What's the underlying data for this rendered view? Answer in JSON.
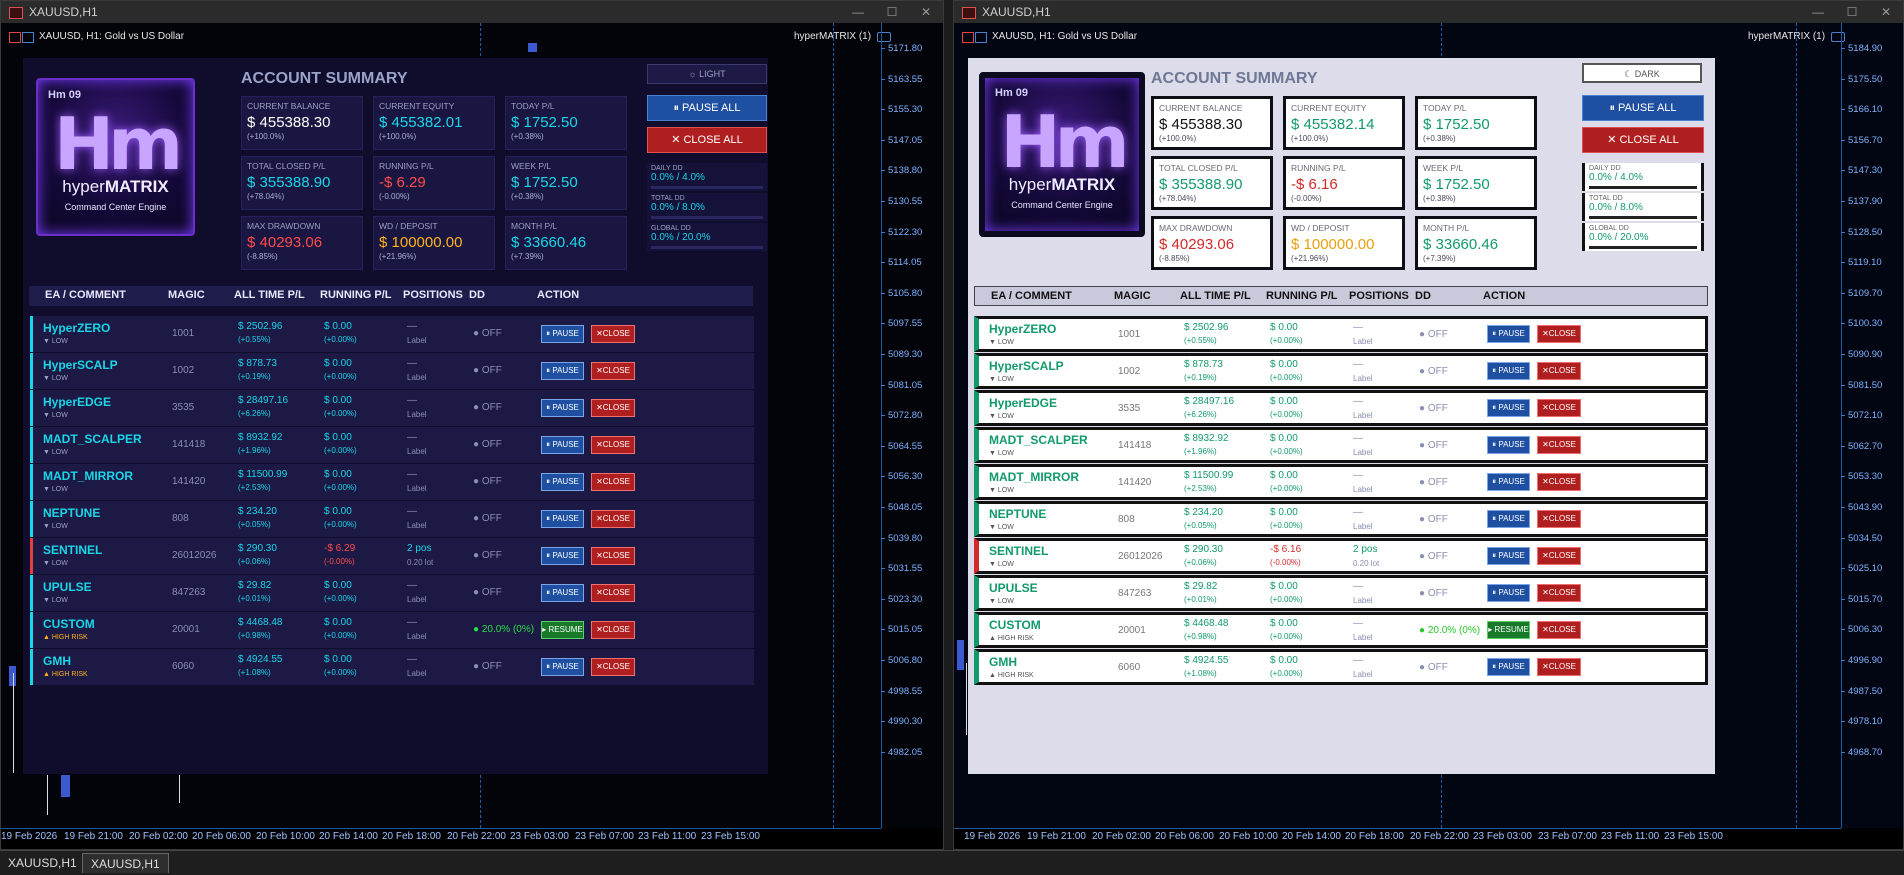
{
  "left_window": {
    "title": "XAUUSD,H1",
    "chart_title": "XAUUSD, H1:  Gold vs US Dollar",
    "ea_label": "hyperMATRIX (1)",
    "price_ticks": [
      "5171.80",
      "5163.55",
      "5155.30",
      "5147.05",
      "5138.80",
      "5130.55",
      "5122.30",
      "5114.05",
      "5105.80",
      "5097.55",
      "5089.30",
      "5081.05",
      "5072.80",
      "5064.55",
      "5056.30",
      "5048.05",
      "5039.80",
      "5031.55",
      "5023.30",
      "5015.05",
      "5006.80",
      "4998.55",
      "4990.30",
      "4982.05"
    ],
    "time_ticks": [
      "19 Feb 2026",
      "19 Feb 21:00",
      "20 Feb 02:00",
      "20 Feb 06:00",
      "20 Feb 10:00",
      "20 Feb 14:00",
      "20 Feb 18:00",
      "20 Feb 22:00",
      "23 Feb 03:00",
      "23 Feb 07:00",
      "23 Feb 11:00",
      "23 Feb 15:00"
    ]
  },
  "right_window": {
    "title": "XAUUSD,H1",
    "chart_title": "XAUUSD, H1:  Gold vs US Dollar",
    "ea_label": "hyperMATRIX (1)",
    "price_ticks": [
      "5184.90",
      "5175.50",
      "5166.10",
      "5156.70",
      "5147.30",
      "5137.90",
      "5128.50",
      "5119.10",
      "5109.70",
      "5100.30",
      "5090.90",
      "5081.50",
      "5072.10",
      "5062.70",
      "5053.30",
      "5043.90",
      "5034.50",
      "5025.10",
      "5015.70",
      "5006.30",
      "4996.90",
      "4987.50",
      "4978.10",
      "4968.70"
    ],
    "time_ticks": [
      "19 Feb 2026",
      "19 Feb 21:00",
      "20 Feb 02:00",
      "20 Feb 06:00",
      "20 Feb 10:00",
      "20 Feb 14:00",
      "20 Feb 18:00",
      "20 Feb 22:00",
      "23 Feb 03:00",
      "23 Feb 07:00",
      "23 Feb 11:00",
      "23 Feb 15:00"
    ]
  },
  "logo": {
    "badge": "Hm 09",
    "mark": "Hm",
    "brand_a": "hyper",
    "brand_b": "MATRIX",
    "subtitle": "Command Center Engine"
  },
  "summary_title": "ACCOUNT SUMMARY",
  "dark_panel": {
    "mode_button": "☼ LIGHT",
    "cards": [
      {
        "label": "CURRENT BALANCE",
        "value": "$ 455388.30",
        "pct": "(+100.0%)",
        "color": "white"
      },
      {
        "label": "CURRENT EQUITY",
        "value": "$ 455382.01",
        "pct": "(+100.0%)",
        "color": "cyan"
      },
      {
        "label": "TODAY P/L",
        "value": "$ 1752.50",
        "pct": "(+0.38%)",
        "color": "cyan"
      },
      {
        "label": "TOTAL CLOSED P/L",
        "value": "$ 355388.90",
        "pct": "(+78.04%)",
        "color": "cyan"
      },
      {
        "label": "RUNNING P/L",
        "value": "-$ 6.29",
        "pct": "(-0.00%)",
        "color": "red"
      },
      {
        "label": "WEEK P/L",
        "value": "$ 1752.50",
        "pct": "(+0.38%)",
        "color": "cyan"
      },
      {
        "label": "MAX DRAWDOWN",
        "value": "$ 40293.06",
        "pct": "(-8.85%)",
        "color": "red"
      },
      {
        "label": "WD / DEPOSIT",
        "value": "$ 100000.00",
        "pct": "(+21.96%)",
        "color": "orange"
      },
      {
        "label": "MONTH P/L",
        "value": "$ 33660.46",
        "pct": "(+7.39%)",
        "color": "cyan"
      }
    ],
    "running_row8": "-$ 6.29"
  },
  "light_panel": {
    "mode_button": "☾ DARK",
    "cards": [
      {
        "label": "CURRENT BALANCE",
        "value": "$ 455388.30",
        "pct": "(+100.0%)",
        "color": "white"
      },
      {
        "label": "CURRENT EQUITY",
        "value": "$ 455382.14",
        "pct": "(+100.0%)",
        "color": "cyan"
      },
      {
        "label": "TODAY P/L",
        "value": "$ 1752.50",
        "pct": "(+0.38%)",
        "color": "cyan"
      },
      {
        "label": "TOTAL CLOSED P/L",
        "value": "$ 355388.90",
        "pct": "(+78.04%)",
        "color": "cyan"
      },
      {
        "label": "RUNNING P/L",
        "value": "-$ 6.16",
        "pct": "(-0.00%)",
        "color": "red"
      },
      {
        "label": "WEEK P/L",
        "value": "$ 1752.50",
        "pct": "(+0.38%)",
        "color": "cyan"
      },
      {
        "label": "MAX DRAWDOWN",
        "value": "$ 40293.06",
        "pct": "(-8.85%)",
        "color": "red"
      },
      {
        "label": "WD / DEPOSIT",
        "value": "$ 100000.00",
        "pct": "(+21.96%)",
        "color": "orange"
      },
      {
        "label": "MONTH P/L",
        "value": "$ 33660.46",
        "pct": "(+7.39%)",
        "color": "cyan"
      }
    ],
    "running_row8": "-$ 6.16"
  },
  "actions": {
    "pause_all": "PAUSE ALL",
    "close_all": "CLOSE ALL"
  },
  "drawdowns": [
    {
      "label": "DAILY DD",
      "value": "0.0% / 4.0%"
    },
    {
      "label": "TOTAL DD",
      "value": "0.0% / 8.0%"
    },
    {
      "label": "GLOBAL DD",
      "value": "0.0% / 20.0%"
    }
  ],
  "table_headers": [
    "EA / COMMENT",
    "MAGIC",
    "ALL TIME P/L",
    "RUNNING P/L",
    "POSITIONS",
    "DD",
    "ACTION"
  ],
  "buttons": {
    "pause": "PAUSE",
    "resume": "RESUME",
    "close": "CLOSE"
  },
  "rows": [
    {
      "name": "HyperZERO",
      "risk": "▼ LOW",
      "magic": "1001",
      "atpl": "$ 2502.96",
      "atpl_pct": "(+0.55%)",
      "run": "$ 0.00",
      "run_pct": "(+0.00%)",
      "pos": "—",
      "pos_sub": "Label",
      "dd": "● OFF",
      "state": "pause"
    },
    {
      "name": "HyperSCALP",
      "risk": "▼ LOW",
      "magic": "1002",
      "atpl": "$ 878.73",
      "atpl_pct": "(+0.19%)",
      "run": "$ 0.00",
      "run_pct": "(+0.00%)",
      "pos": "—",
      "pos_sub": "Label",
      "dd": "● OFF",
      "state": "pause"
    },
    {
      "name": "HyperEDGE",
      "risk": "▼ LOW",
      "magic": "3535",
      "atpl": "$ 28497.16",
      "atpl_pct": "(+6.26%)",
      "run": "$ 0.00",
      "run_pct": "(+0.00%)",
      "pos": "—",
      "pos_sub": "Label",
      "dd": "● OFF",
      "state": "pause"
    },
    {
      "name": "MADT_SCALPER",
      "risk": "▼ LOW",
      "magic": "141418",
      "atpl": "$ 8932.92",
      "atpl_pct": "(+1.96%)",
      "run": "$ 0.00",
      "run_pct": "(+0.00%)",
      "pos": "—",
      "pos_sub": "Label",
      "dd": "● OFF",
      "state": "pause"
    },
    {
      "name": "MADT_MIRROR",
      "risk": "▼ LOW",
      "magic": "141420",
      "atpl": "$ 11500.99",
      "atpl_pct": "(+2.53%)",
      "run": "$ 0.00",
      "run_pct": "(+0.00%)",
      "pos": "—",
      "pos_sub": "Label",
      "dd": "● OFF",
      "state": "pause"
    },
    {
      "name": "NEPTUNE",
      "risk": "▼ LOW",
      "magic": "808",
      "atpl": "$ 234.20",
      "atpl_pct": "(+0.05%)",
      "run": "$ 0.00",
      "run_pct": "(+0.00%)",
      "pos": "—",
      "pos_sub": "Label",
      "dd": "● OFF",
      "state": "pause"
    },
    {
      "name": "SENTINEL",
      "risk": "▼ LOW",
      "magic": "26012026",
      "atpl": "$ 290.30",
      "atpl_pct": "(+0.06%)",
      "run": "",
      "run_pct": "(-0.00%)",
      "pos": "2 pos",
      "pos_sub": "0.20 lot",
      "dd": "● OFF",
      "state": "pause",
      "neg": true
    },
    {
      "name": "UPULSE",
      "risk": "▼ LOW",
      "magic": "847263",
      "atpl": "$ 29.82",
      "atpl_pct": "(+0.01%)",
      "run": "$ 0.00",
      "run_pct": "(+0.00%)",
      "pos": "—",
      "pos_sub": "Label",
      "dd": "● OFF",
      "state": "pause"
    },
    {
      "name": "CUSTOM",
      "risk": "▲ HIGH RISK",
      "magic": "20001",
      "atpl": "$ 4468.48",
      "atpl_pct": "(+0.98%)",
      "run": "$ 0.00",
      "run_pct": "(+0.00%)",
      "pos": "—",
      "pos_sub": "Label",
      "dd": "● 20.0% (0%)",
      "state": "resume"
    },
    {
      "name": "GMH",
      "risk": "▲ HIGH RISK",
      "magic": "6060",
      "atpl": "$ 4924.55",
      "atpl_pct": "(+1.08%)",
      "run": "$ 0.00",
      "run_pct": "(+0.00%)",
      "pos": "—",
      "pos_sub": "Label",
      "dd": "● OFF",
      "state": "pause"
    }
  ],
  "taskbar": {
    "tabs": [
      "XAUUSD,H1",
      "XAUUSD,H1"
    ]
  },
  "colors": {
    "accent_cyan": "#19d6e8",
    "negative": "#ff4a4a",
    "warning": "#ffb21a",
    "pause_blue": "#1f4fa0",
    "close_red": "#b01f1f",
    "resume_green": "#187a28"
  }
}
